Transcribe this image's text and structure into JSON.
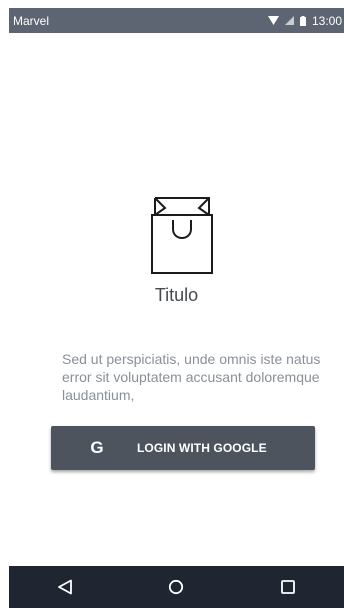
{
  "status_bar": {
    "carrier": "Marvel",
    "time": "13:00",
    "icons": [
      "wifi-icon",
      "signal-icon",
      "battery-icon"
    ]
  },
  "main": {
    "logo_icon": "shopping-bag-icon",
    "title": "Titulo",
    "description": "Sed ut perspiciatis, unde omnis iste natus error sit voluptatem accusant doloremque laudantium,"
  },
  "login": {
    "icon_glyph": "G",
    "label": "LOGIN WITH GOOGLE"
  },
  "nav_bar": {
    "buttons": [
      "back-icon",
      "home-icon",
      "recents-icon"
    ]
  },
  "colors": {
    "status_bar": "#5e6572",
    "button": "#4d545e",
    "nav_bar": "#1f2631",
    "title_text": "#444a52",
    "desc_text": "#8a9098"
  }
}
